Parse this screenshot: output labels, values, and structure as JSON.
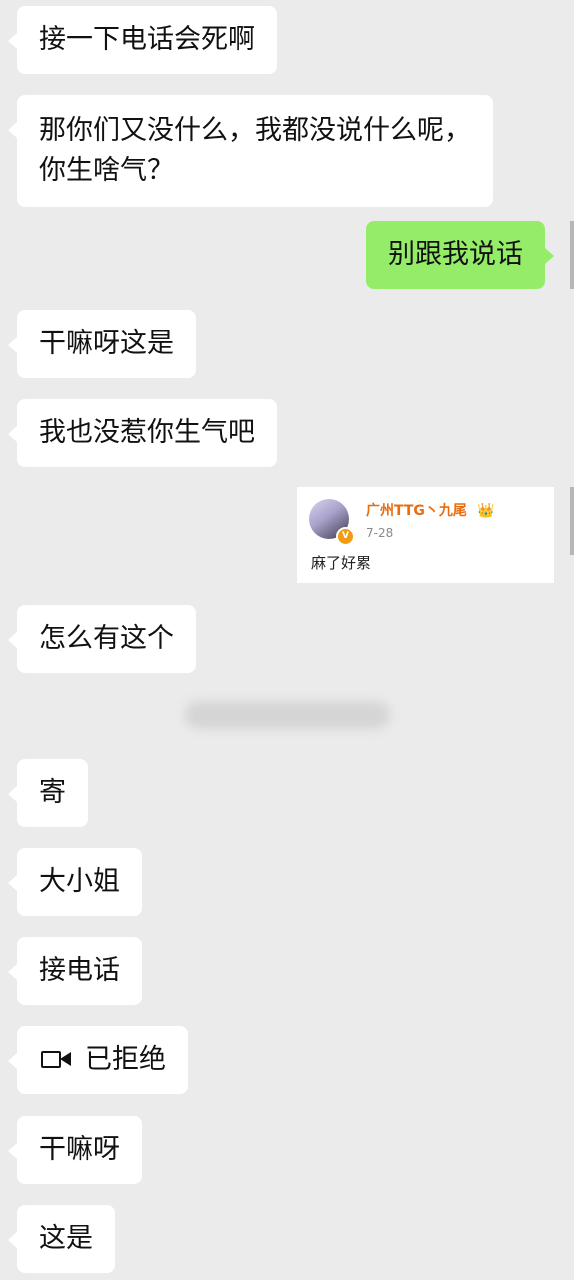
{
  "chat": {
    "messages": [
      {
        "lines": [
          "接一下电话会死啊"
        ]
      },
      {
        "lines": [
          "那你们又没什么，我都没说什么呢，",
          "你生啥气？"
        ]
      },
      {
        "lines": [
          "别跟我说话"
        ]
      },
      {
        "lines": [
          "干嘛呀这是"
        ]
      },
      {
        "lines": [
          "我也没惹你生气吧"
        ]
      },
      {
        "lines": [
          "怎么有这个"
        ]
      },
      {
        "lines": [
          "寄"
        ]
      },
      {
        "lines": [
          "大小姐"
        ]
      },
      {
        "lines": [
          "接电话"
        ]
      },
      {
        "lines": [
          "已拒绝"
        ]
      },
      {
        "lines": [
          "干嘛呀"
        ]
      },
      {
        "lines": [
          "这是"
        ]
      }
    ],
    "image_card": {
      "username": "广州TTG丶九尾",
      "date": "7-28",
      "text": "麻了好累",
      "crown_icon": "👑",
      "badge": "V"
    },
    "colors": {
      "background": "#ebebeb",
      "incoming_bubble": "#ffffff",
      "outgoing_bubble": "#95ec69",
      "username": "#ea6c10"
    }
  }
}
